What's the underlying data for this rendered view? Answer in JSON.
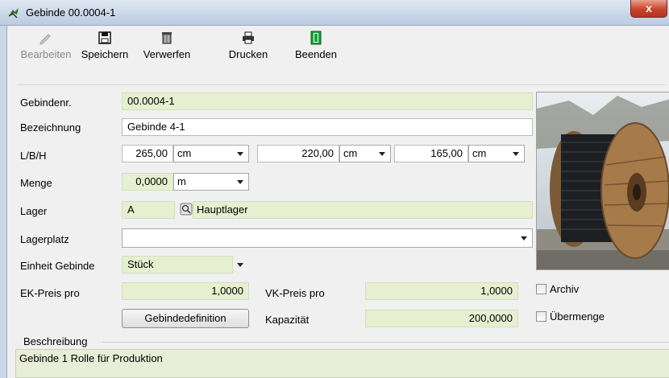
{
  "window": {
    "title": "Gebinde 00.0004-1",
    "close_label": "x"
  },
  "toolbar": {
    "edit": "Bearbeiten",
    "save": "Speichern",
    "discard": "Verwerfen",
    "print": "Drucken",
    "exit": "Beenden"
  },
  "form": {
    "gebindenr_label": "Gebindenr.",
    "gebindenr_value": "00.0004-1",
    "bezeichnung_label": "Bezeichnung",
    "bezeichnung_value": "Gebinde 4-1",
    "lbh_label": "L/B/H",
    "length_value": "265,00",
    "length_unit": "cm",
    "width_value": "220,00",
    "width_unit": "cm",
    "height_value": "165,00",
    "height_unit": "cm",
    "menge_label": "Menge",
    "menge_value": "0,0000",
    "menge_unit": "m",
    "lager_label": "Lager",
    "lager_code": "A",
    "lager_name": "Hauptlager",
    "lagerplatz_label": "Lagerplatz",
    "lagerplatz_value": "",
    "einheit_label": "Einheit Gebinde",
    "einheit_value": "Stück",
    "ek_label": "EK-Preis pro",
    "ek_value": "1,0000",
    "vk_label": "VK-Preis pro",
    "vk_value": "1,0000",
    "gebindedefinition_button": "Gebindedefinition",
    "kapazitaet_label": "Kapazität",
    "kapazitaet_value": "200,0000",
    "archiv_label": "Archiv",
    "archiv_checked": false,
    "uebermenge_label": "Übermenge",
    "uebermenge_checked": false,
    "beschreibung_label": "Beschreibung",
    "beschreibung_value": "Gebinde 1 Rolle für Produktion"
  },
  "colors": {
    "field_green": "#e6efcf",
    "window_bg": "#f0f0f0",
    "close_red": "#c7432c"
  },
  "icons": {
    "edit": "pencil-icon",
    "save": "floppy-disk-icon",
    "discard": "trash-can-icon",
    "print": "printer-icon",
    "exit": "exit-door-icon",
    "lookup": "lookup-icon",
    "app": "app-icon"
  }
}
